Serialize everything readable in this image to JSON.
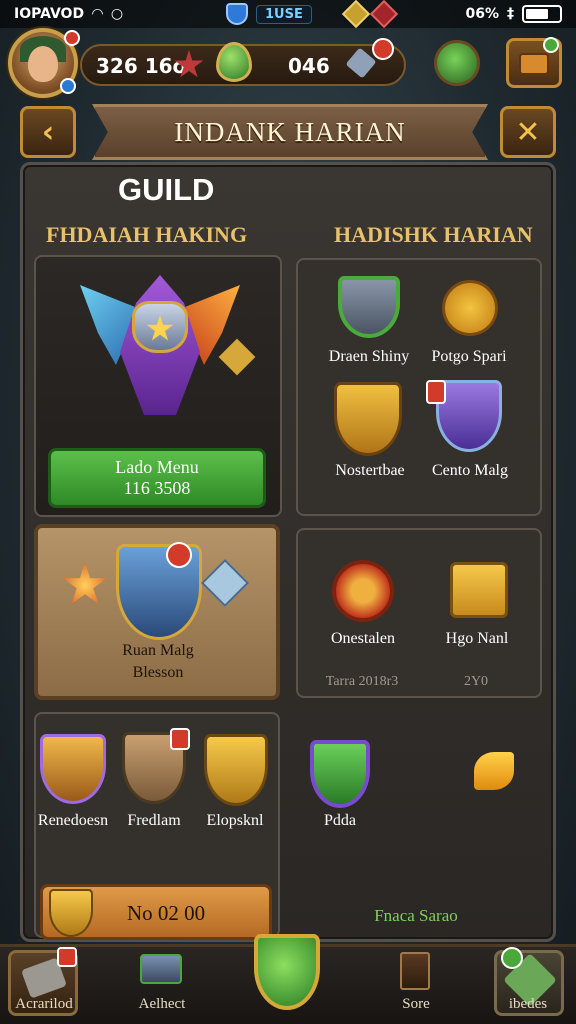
{
  "status_bar": {
    "carrier": "IOPAVOD",
    "center_text": "1USE",
    "battery_text": "06%"
  },
  "resources": {
    "value_left": "326 16o",
    "value_right": "046"
  },
  "header": {
    "title": "INDANK HARIAN"
  },
  "guild_label": "GUILD",
  "left_section": {
    "title": "FHDAIAH HAKING",
    "button_line1": "Lado Menu",
    "button_line2": "116 3508"
  },
  "right_section": {
    "title": "HADISHK HARIAN",
    "items": [
      {
        "label": "Draen Shiny",
        "icon": "anvil-icon"
      },
      {
        "label": "Potgo Spari",
        "icon": "gold-coin-icon"
      },
      {
        "label": "Nostertbae",
        "icon": "gold-shield-icon"
      },
      {
        "label": "Cento Malg",
        "icon": "purple-crest-icon"
      }
    ]
  },
  "hero_card": {
    "line1": "Ruan Malg",
    "line2": "Blesson"
  },
  "mid_right_card": {
    "items": [
      {
        "label": "Onestalen",
        "icon": "red-emblem-icon"
      },
      {
        "label": "Hgo Nanl",
        "icon": "golden-chest-icon"
      }
    ],
    "footer_left": "Tarra 2018r3",
    "footer_right": "2Y0"
  },
  "bottom_left_card": {
    "items": [
      {
        "label": "Renedoesn",
        "icon": "jeweled-crest-icon"
      },
      {
        "label": "Fredlam",
        "icon": "staff-crest-icon"
      },
      {
        "label": "Elopsknl",
        "icon": "gold-crest-icon"
      }
    ],
    "button_label": "No 02 00"
  },
  "bottom_right": {
    "item_label": "Pdda",
    "footer": "Fnaca Sarao"
  },
  "bottom_nav": [
    {
      "label": "Acrarilod",
      "icon": "scroll-icon"
    },
    {
      "label": "Aelhect",
      "icon": "anvil-icon"
    },
    {
      "label": "",
      "icon": "green-gem-icon"
    },
    {
      "label": "Sore",
      "icon": "book-icon"
    },
    {
      "label": "ibedes",
      "icon": "tools-icon"
    }
  ],
  "colors": {
    "accent_gold": "#e8c16a",
    "button_green": "#5cc04a",
    "button_orange": "#e09a48",
    "badge_red": "#d23a2a"
  }
}
